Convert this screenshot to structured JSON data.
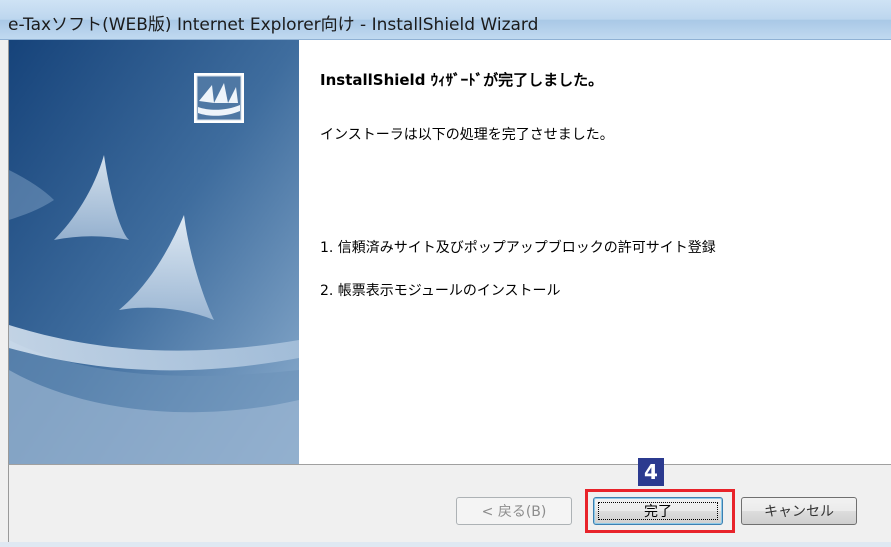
{
  "window": {
    "title": "e-Taxソフト(WEB版) Internet Explorer向け - InstallShield Wizard"
  },
  "main": {
    "heading": "InstallShield ｳｨｻﾞｰﾄﾞが完了しました。",
    "description": "インストーラは以下の処理を完了させました。",
    "items": [
      "1. 信頼済みサイト及びポップアップブロックの許可サイト登録",
      "2. 帳票表示モジュールのインストール"
    ]
  },
  "buttons": {
    "back": "< 戻る(B)",
    "finish": "完了",
    "cancel": "キャンセル"
  },
  "annotation": {
    "step_number": "4",
    "highlight_color": "#e8232a",
    "badge_color": "#2b3a8f"
  },
  "icons": {
    "logo": "installshield-logo-icon"
  }
}
